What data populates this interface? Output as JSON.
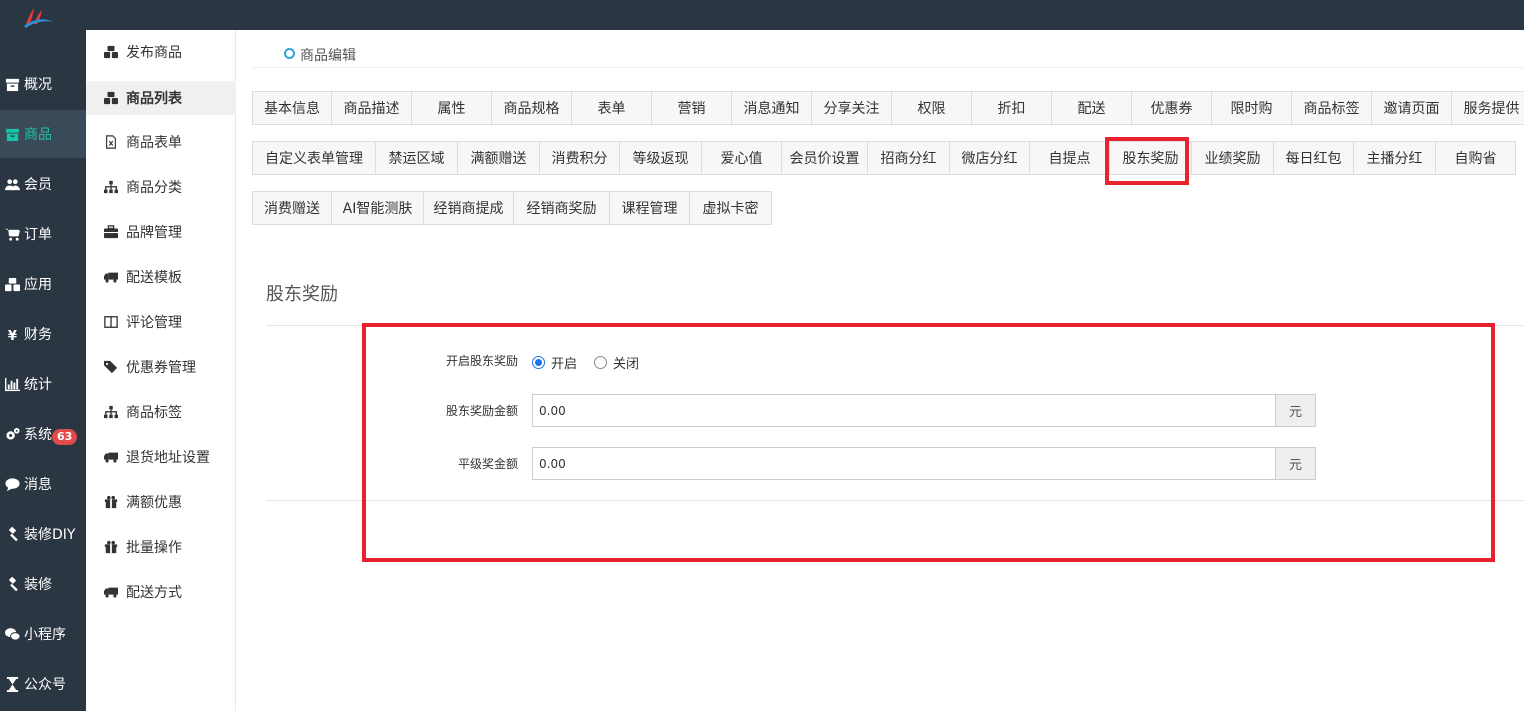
{
  "nav": {
    "items": [
      {
        "label": "概况",
        "icon": "archive-icon"
      },
      {
        "label": "商品",
        "icon": "archive-icon"
      },
      {
        "label": "会员",
        "icon": "users-icon"
      },
      {
        "label": "订单",
        "icon": "cart-icon"
      },
      {
        "label": "应用",
        "icon": "cubes-icon"
      },
      {
        "label": "财务",
        "icon": "yen-icon"
      },
      {
        "label": "统计",
        "icon": "bar-chart-icon"
      },
      {
        "label": "系统",
        "icon": "gears-icon"
      },
      {
        "label": "消息",
        "icon": "comment-icon"
      },
      {
        "label": "装修DIY",
        "icon": "gavel-icon"
      },
      {
        "label": "装修",
        "icon": "gavel-icon"
      },
      {
        "label": "小程序",
        "icon": "wechat-icon"
      },
      {
        "label": "公众号",
        "icon": "hourglass-icon"
      }
    ],
    "active_index": 1,
    "message_badge": "63",
    "accent_color": "#19c2a6"
  },
  "subnav": {
    "items": [
      {
        "label": "发布商品",
        "icon": "cubes-icon"
      },
      {
        "label": "商品列表",
        "icon": "cubes-icon"
      },
      {
        "label": "商品表单",
        "icon": "file-excel-icon"
      },
      {
        "label": "商品分类",
        "icon": "sitemap-icon"
      },
      {
        "label": "品牌管理",
        "icon": "briefcase-icon"
      },
      {
        "label": "配送模板",
        "icon": "truck-icon"
      },
      {
        "label": "评论管理",
        "icon": "columns-icon"
      },
      {
        "label": "优惠券管理",
        "icon": "tags-icon"
      },
      {
        "label": "商品标签",
        "icon": "sitemap-icon"
      },
      {
        "label": "退货地址设置",
        "icon": "truck-icon"
      },
      {
        "label": "满额优惠",
        "icon": "gift-icon"
      },
      {
        "label": "批量操作",
        "icon": "gift-icon"
      },
      {
        "label": "配送方式",
        "icon": "truck-icon"
      }
    ],
    "active_index": 1
  },
  "breadcrumb": {
    "label": "商品编辑"
  },
  "tabs": {
    "row1": [
      "基本信息",
      "商品描述",
      "属性",
      "商品规格",
      "表单",
      "营销",
      "消息通知",
      "分享关注",
      "权限",
      "折扣",
      "配送",
      "优惠券",
      "限时购",
      "商品标签",
      "邀请页面",
      "服务提供"
    ],
    "row2": [
      "自定义表单管理",
      "禁运区域",
      "满额赠送",
      "消费积分",
      "等级返现",
      "爱心值",
      "会员价设置",
      "招商分红",
      "微店分红",
      "自提点",
      "股东奖励",
      "业绩奖励",
      "每日红包",
      "主播分红",
      "自购省"
    ],
    "row3": [
      "消费赠送",
      "AI智能测肤",
      "经销商提成",
      "经销商奖励",
      "课程管理",
      "虚拟卡密"
    ],
    "selected": "股东奖励"
  },
  "section": {
    "title": "股东奖励"
  },
  "form": {
    "enable_label": "开启股东奖励",
    "enable_on": "开启",
    "enable_off": "关闭",
    "enable_value": "开启",
    "amount_label": "股东奖励金额",
    "amount_value": "0.00",
    "amount_unit": "元",
    "peer_label": "平级奖金额",
    "peer_value": "0.00",
    "peer_unit": "元"
  },
  "colors": {
    "topbar": "#2b3643",
    "highlight": "#e8222f",
    "radio_on": "#1a73e8",
    "badge": "#e04b4b"
  }
}
